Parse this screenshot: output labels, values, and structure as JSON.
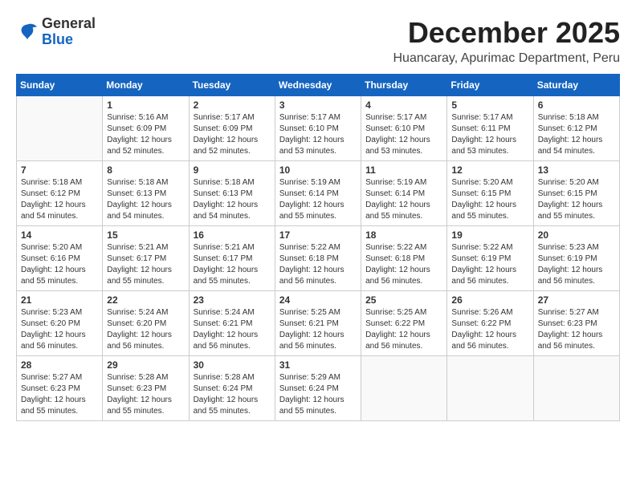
{
  "header": {
    "logo": {
      "general": "General",
      "blue": "Blue"
    },
    "month": "December 2025",
    "location": "Huancaray, Apurimac Department, Peru"
  },
  "weekdays": [
    "Sunday",
    "Monday",
    "Tuesday",
    "Wednesday",
    "Thursday",
    "Friday",
    "Saturday"
  ],
  "weeks": [
    [
      {
        "day": "",
        "sunrise": "",
        "sunset": "",
        "daylight": ""
      },
      {
        "day": "1",
        "sunrise": "Sunrise: 5:16 AM",
        "sunset": "Sunset: 6:09 PM",
        "daylight": "Daylight: 12 hours and 52 minutes."
      },
      {
        "day": "2",
        "sunrise": "Sunrise: 5:17 AM",
        "sunset": "Sunset: 6:09 PM",
        "daylight": "Daylight: 12 hours and 52 minutes."
      },
      {
        "day": "3",
        "sunrise": "Sunrise: 5:17 AM",
        "sunset": "Sunset: 6:10 PM",
        "daylight": "Daylight: 12 hours and 53 minutes."
      },
      {
        "day": "4",
        "sunrise": "Sunrise: 5:17 AM",
        "sunset": "Sunset: 6:10 PM",
        "daylight": "Daylight: 12 hours and 53 minutes."
      },
      {
        "day": "5",
        "sunrise": "Sunrise: 5:17 AM",
        "sunset": "Sunset: 6:11 PM",
        "daylight": "Daylight: 12 hours and 53 minutes."
      },
      {
        "day": "6",
        "sunrise": "Sunrise: 5:18 AM",
        "sunset": "Sunset: 6:12 PM",
        "daylight": "Daylight: 12 hours and 54 minutes."
      }
    ],
    [
      {
        "day": "7",
        "sunrise": "Sunrise: 5:18 AM",
        "sunset": "Sunset: 6:12 PM",
        "daylight": "Daylight: 12 hours and 54 minutes."
      },
      {
        "day": "8",
        "sunrise": "Sunrise: 5:18 AM",
        "sunset": "Sunset: 6:13 PM",
        "daylight": "Daylight: 12 hours and 54 minutes."
      },
      {
        "day": "9",
        "sunrise": "Sunrise: 5:18 AM",
        "sunset": "Sunset: 6:13 PM",
        "daylight": "Daylight: 12 hours and 54 minutes."
      },
      {
        "day": "10",
        "sunrise": "Sunrise: 5:19 AM",
        "sunset": "Sunset: 6:14 PM",
        "daylight": "Daylight: 12 hours and 55 minutes."
      },
      {
        "day": "11",
        "sunrise": "Sunrise: 5:19 AM",
        "sunset": "Sunset: 6:14 PM",
        "daylight": "Daylight: 12 hours and 55 minutes."
      },
      {
        "day": "12",
        "sunrise": "Sunrise: 5:20 AM",
        "sunset": "Sunset: 6:15 PM",
        "daylight": "Daylight: 12 hours and 55 minutes."
      },
      {
        "day": "13",
        "sunrise": "Sunrise: 5:20 AM",
        "sunset": "Sunset: 6:15 PM",
        "daylight": "Daylight: 12 hours and 55 minutes."
      }
    ],
    [
      {
        "day": "14",
        "sunrise": "Sunrise: 5:20 AM",
        "sunset": "Sunset: 6:16 PM",
        "daylight": "Daylight: 12 hours and 55 minutes."
      },
      {
        "day": "15",
        "sunrise": "Sunrise: 5:21 AM",
        "sunset": "Sunset: 6:17 PM",
        "daylight": "Daylight: 12 hours and 55 minutes."
      },
      {
        "day": "16",
        "sunrise": "Sunrise: 5:21 AM",
        "sunset": "Sunset: 6:17 PM",
        "daylight": "Daylight: 12 hours and 55 minutes."
      },
      {
        "day": "17",
        "sunrise": "Sunrise: 5:22 AM",
        "sunset": "Sunset: 6:18 PM",
        "daylight": "Daylight: 12 hours and 56 minutes."
      },
      {
        "day": "18",
        "sunrise": "Sunrise: 5:22 AM",
        "sunset": "Sunset: 6:18 PM",
        "daylight": "Daylight: 12 hours and 56 minutes."
      },
      {
        "day": "19",
        "sunrise": "Sunrise: 5:22 AM",
        "sunset": "Sunset: 6:19 PM",
        "daylight": "Daylight: 12 hours and 56 minutes."
      },
      {
        "day": "20",
        "sunrise": "Sunrise: 5:23 AM",
        "sunset": "Sunset: 6:19 PM",
        "daylight": "Daylight: 12 hours and 56 minutes."
      }
    ],
    [
      {
        "day": "21",
        "sunrise": "Sunrise: 5:23 AM",
        "sunset": "Sunset: 6:20 PM",
        "daylight": "Daylight: 12 hours and 56 minutes."
      },
      {
        "day": "22",
        "sunrise": "Sunrise: 5:24 AM",
        "sunset": "Sunset: 6:20 PM",
        "daylight": "Daylight: 12 hours and 56 minutes."
      },
      {
        "day": "23",
        "sunrise": "Sunrise: 5:24 AM",
        "sunset": "Sunset: 6:21 PM",
        "daylight": "Daylight: 12 hours and 56 minutes."
      },
      {
        "day": "24",
        "sunrise": "Sunrise: 5:25 AM",
        "sunset": "Sunset: 6:21 PM",
        "daylight": "Daylight: 12 hours and 56 minutes."
      },
      {
        "day": "25",
        "sunrise": "Sunrise: 5:25 AM",
        "sunset": "Sunset: 6:22 PM",
        "daylight": "Daylight: 12 hours and 56 minutes."
      },
      {
        "day": "26",
        "sunrise": "Sunrise: 5:26 AM",
        "sunset": "Sunset: 6:22 PM",
        "daylight": "Daylight: 12 hours and 56 minutes."
      },
      {
        "day": "27",
        "sunrise": "Sunrise: 5:27 AM",
        "sunset": "Sunset: 6:23 PM",
        "daylight": "Daylight: 12 hours and 56 minutes."
      }
    ],
    [
      {
        "day": "28",
        "sunrise": "Sunrise: 5:27 AM",
        "sunset": "Sunset: 6:23 PM",
        "daylight": "Daylight: 12 hours and 55 minutes."
      },
      {
        "day": "29",
        "sunrise": "Sunrise: 5:28 AM",
        "sunset": "Sunset: 6:23 PM",
        "daylight": "Daylight: 12 hours and 55 minutes."
      },
      {
        "day": "30",
        "sunrise": "Sunrise: 5:28 AM",
        "sunset": "Sunset: 6:24 PM",
        "daylight": "Daylight: 12 hours and 55 minutes."
      },
      {
        "day": "31",
        "sunrise": "Sunrise: 5:29 AM",
        "sunset": "Sunset: 6:24 PM",
        "daylight": "Daylight: 12 hours and 55 minutes."
      },
      {
        "day": "",
        "sunrise": "",
        "sunset": "",
        "daylight": ""
      },
      {
        "day": "",
        "sunrise": "",
        "sunset": "",
        "daylight": ""
      },
      {
        "day": "",
        "sunrise": "",
        "sunset": "",
        "daylight": ""
      }
    ]
  ]
}
